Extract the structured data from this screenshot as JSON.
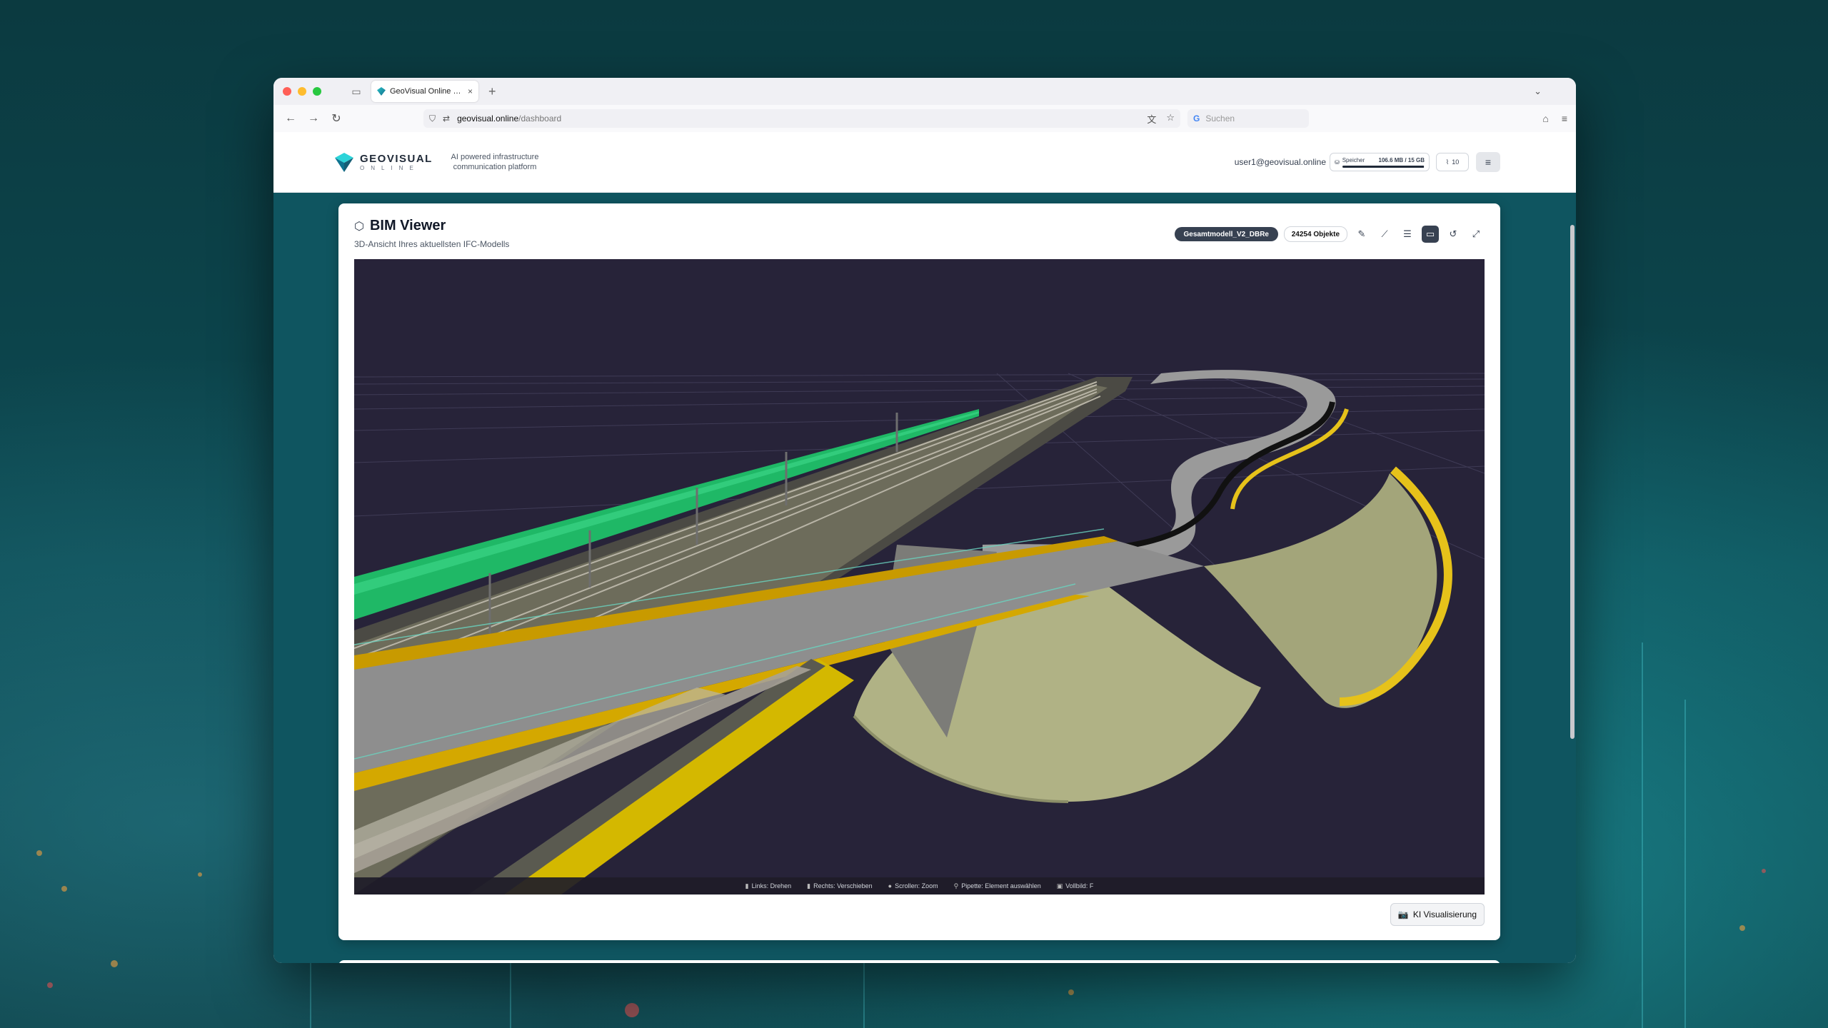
{
  "browser": {
    "tab_title": "GeoVisual Online – Geodaten &",
    "tab_close": "×",
    "tab_new": "+",
    "url_host": "geovisual.online",
    "url_path": "/dashboard",
    "search_placeholder": "Suchen"
  },
  "header": {
    "logo_name": "GEOVISUAL",
    "logo_sub": "ONLINE",
    "tagline_line1": "AI powered infrastructure",
    "tagline_line2": "communication platform",
    "user_email": "user1@geovisual.online",
    "storage_label": "Speicher",
    "storage_value": "106.6 MB / 15 GB",
    "storage_fraction": 0.99,
    "count_value": "10"
  },
  "viewer_card": {
    "title": "BIM Viewer",
    "subtitle": "3D-Ansicht Ihres aktuellsten IFC-Modells",
    "model_name": "Gesamtmodell_V2_DBRe",
    "object_count": "24254 Objekte",
    "hints": [
      "Links: Drehen",
      "Rechts: Verschieben",
      "Scrollen: Zoom",
      "Pipette: Element auswählen",
      "Vollbild: F"
    ],
    "ki_button": "KI Visualisierung"
  },
  "colors": {
    "viewer_bg": "#272339",
    "accent_dark": "#374151",
    "noise_wall": "#1fb866",
    "bridge_yellow": "#d4a800",
    "embankment": "#a3a57a"
  }
}
